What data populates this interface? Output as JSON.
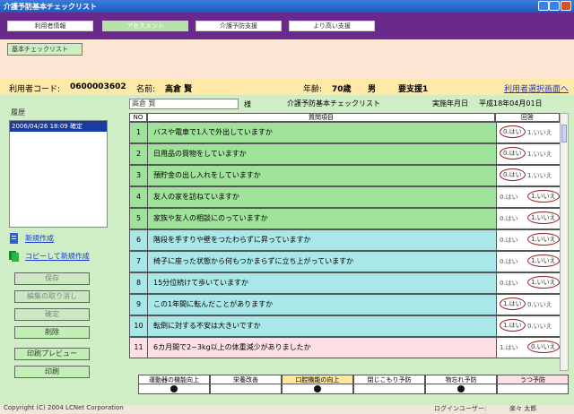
{
  "window": {
    "title": "介護予防基本チェックリスト"
  },
  "nav": {
    "tabs": [
      "利用者情報",
      "アセスメント",
      "介護予防支援",
      "より高い支援"
    ]
  },
  "subnav": {
    "button": "基本チェックリスト"
  },
  "info": {
    "user_code_label": "利用者コード:",
    "user_code": "0600003602",
    "name_label": "名前:",
    "name": "高倉 賢",
    "age_label": "年齢:",
    "age": "70歳",
    "sex": "男",
    "care_level": "要支援1",
    "link": "利用者選択画面へ"
  },
  "history": {
    "title": "履歴",
    "items": [
      "2006/04/26 18:09 確定"
    ]
  },
  "side": {
    "new_link": "新規作成",
    "copy_link": "コピーして新規作成",
    "buttons": [
      "保存",
      "編集の取り消し",
      "確定",
      "削除",
      "印刷プレビュー",
      "印刷"
    ]
  },
  "form": {
    "name_value": "高倉 賢",
    "sama": "様",
    "title": "介護予防基本チェックリスト",
    "date_label": "実施年月日",
    "date": "平成18年04月01日"
  },
  "table": {
    "headers": [
      "NO",
      "質問項目",
      "回答"
    ],
    "options": [
      "0.はい",
      "1.いいえ"
    ],
    "options_alt": [
      "1.はい",
      "0.いいえ"
    ],
    "rows": [
      {
        "no": "1",
        "q": "バスや電車で1人で外出していますか",
        "color": "#9fe39a",
        "sel": 0,
        "alt": false
      },
      {
        "no": "2",
        "q": "日用品の買物をしていますか",
        "color": "#9fe39a",
        "sel": 0,
        "alt": false
      },
      {
        "no": "3",
        "q": "預貯金の出し入れをしていますか",
        "color": "#9fe39a",
        "sel": 0,
        "alt": false
      },
      {
        "no": "4",
        "q": "友人の家を訪ねていますか",
        "color": "#9fe39a",
        "sel": 1,
        "alt": false
      },
      {
        "no": "5",
        "q": "家族や友人の相談にのっていますか",
        "color": "#9fe39a",
        "sel": 1,
        "alt": false
      },
      {
        "no": "6",
        "q": "階段を手すりや壁をつたわらずに昇っていますか",
        "color": "#a9e8e8",
        "sel": 1,
        "alt": false
      },
      {
        "no": "7",
        "q": "椅子に座った状態から何もつかまらずに立ち上がっていますか",
        "color": "#a9e8e8",
        "sel": 1,
        "alt": false
      },
      {
        "no": "8",
        "q": "15分位続けて歩いていますか",
        "color": "#a9e8e8",
        "sel": 1,
        "alt": false
      },
      {
        "no": "9",
        "q": "この1年間に転んだことがありますか",
        "color": "#a9e8e8",
        "sel": 0,
        "alt": true
      },
      {
        "no": "10",
        "q": "転倒に対する不安は大きいですか",
        "color": "#a9e8e8",
        "sel": 0,
        "alt": true
      },
      {
        "no": "11",
        "q": "6カ月間で2~3kg以上の体重減少がありましたか",
        "color": "#fde0e4",
        "sel": 1,
        "alt": true
      }
    ]
  },
  "categories": [
    {
      "label": "運動器の機能向上",
      "color": "#ffffff",
      "dot": true
    },
    {
      "label": "栄養改善",
      "color": "#ffffff",
      "dot": false
    },
    {
      "label": "口腔機能の向上",
      "color": "#ffe89a",
      "dot": true
    },
    {
      "label": "閉じこもり予防",
      "color": "#ffffff",
      "dot": false
    },
    {
      "label": "物忘れ予防",
      "color": "#ffffff",
      "dot": true
    },
    {
      "label": "うつ予防",
      "color": "#fde0e4",
      "dot": false
    }
  ],
  "footer": {
    "copyright": "Copyright (C) 2004 LCNet Corporation",
    "login_label": "ログインユーザー:",
    "login_user": "楽々 太郎"
  }
}
